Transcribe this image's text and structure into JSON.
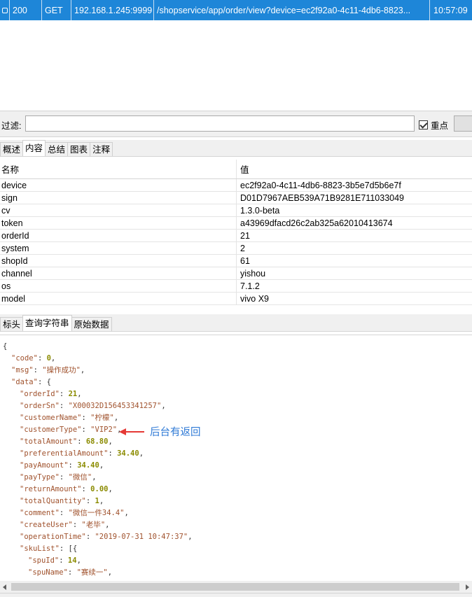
{
  "request": {
    "status": "200",
    "method": "GET",
    "host": "192.168.1.245:9999",
    "url": "/shopservice/app/order/view?device=ec2f92a0-4c11-4db6-8823...",
    "time": "10:57:09"
  },
  "filter": {
    "label": "过滤:",
    "value": "",
    "checkbox_label": "重点"
  },
  "tabs_top": [
    "概述",
    "内容",
    "总结",
    "图表",
    "注释"
  ],
  "params": {
    "header_name": "名称",
    "header_value": "值",
    "rows": [
      {
        "k": "device",
        "v": "ec2f92a0-4c11-4db6-8823-3b5e7d5b6e7f"
      },
      {
        "k": "sign",
        "v": "D01D7967AEB539A71B9281E711033049"
      },
      {
        "k": "cv",
        "v": "1.3.0-beta"
      },
      {
        "k": "token",
        "v": "a43969dfacd26c2ab325a62010413674"
      },
      {
        "k": "orderId",
        "v": "21"
      },
      {
        "k": "system",
        "v": "2"
      },
      {
        "k": "shopId",
        "v": "61"
      },
      {
        "k": "channel",
        "v": "yishou"
      },
      {
        "k": "os",
        "v": "7.1.2"
      },
      {
        "k": "model",
        "v": "vivo X9"
      }
    ]
  },
  "tabs_bottom": [
    "标头",
    "查询字符串",
    "原始数据"
  ],
  "json_lines": [
    {
      "indent": 0,
      "parts": [
        [
          "p",
          "{"
        ]
      ]
    },
    {
      "indent": 1,
      "parts": [
        [
          "k",
          "\"code\""
        ],
        [
          "p",
          ": "
        ],
        [
          "n",
          "0"
        ],
        [
          "p",
          ","
        ]
      ]
    },
    {
      "indent": 1,
      "parts": [
        [
          "k",
          "\"msg\""
        ],
        [
          "p",
          ": "
        ],
        [
          "s",
          "\"操作成功\""
        ],
        [
          "p",
          ","
        ]
      ]
    },
    {
      "indent": 1,
      "parts": [
        [
          "k",
          "\"data\""
        ],
        [
          "p",
          ": {"
        ]
      ]
    },
    {
      "indent": 2,
      "parts": [
        [
          "k",
          "\"orderId\""
        ],
        [
          "p",
          ": "
        ],
        [
          "n",
          "21"
        ],
        [
          "p",
          ","
        ]
      ]
    },
    {
      "indent": 2,
      "parts": [
        [
          "k",
          "\"orderSn\""
        ],
        [
          "p",
          ": "
        ],
        [
          "s",
          "\"X00032D156453341257\""
        ],
        [
          "p",
          ","
        ]
      ]
    },
    {
      "indent": 2,
      "parts": [
        [
          "k",
          "\"customerName\""
        ],
        [
          "p",
          ": "
        ],
        [
          "s",
          "\"柠檬\""
        ],
        [
          "p",
          ","
        ]
      ]
    },
    {
      "indent": 2,
      "parts": [
        [
          "k",
          "\"customerType\""
        ],
        [
          "p",
          ": "
        ],
        [
          "s",
          "\"VIP2\""
        ],
        [
          "p",
          ","
        ]
      ]
    },
    {
      "indent": 2,
      "parts": [
        [
          "k",
          "\"totalAmount\""
        ],
        [
          "p",
          ": "
        ],
        [
          "n",
          "68.80"
        ],
        [
          "p",
          ","
        ]
      ]
    },
    {
      "indent": 2,
      "parts": [
        [
          "k",
          "\"preferentialAmount\""
        ],
        [
          "p",
          ": "
        ],
        [
          "n",
          "34.40"
        ],
        [
          "p",
          ","
        ]
      ]
    },
    {
      "indent": 2,
      "parts": [
        [
          "k",
          "\"payAmount\""
        ],
        [
          "p",
          ": "
        ],
        [
          "n",
          "34.40"
        ],
        [
          "p",
          ","
        ]
      ]
    },
    {
      "indent": 2,
      "parts": [
        [
          "k",
          "\"payType\""
        ],
        [
          "p",
          ": "
        ],
        [
          "s",
          "\"微信\""
        ],
        [
          "p",
          ","
        ]
      ]
    },
    {
      "indent": 2,
      "parts": [
        [
          "k",
          "\"returnAmount\""
        ],
        [
          "p",
          ": "
        ],
        [
          "n",
          "0.00"
        ],
        [
          "p",
          ","
        ]
      ]
    },
    {
      "indent": 2,
      "parts": [
        [
          "k",
          "\"totalQuantity\""
        ],
        [
          "p",
          ": "
        ],
        [
          "n",
          "1"
        ],
        [
          "p",
          ","
        ]
      ]
    },
    {
      "indent": 2,
      "parts": [
        [
          "k",
          "\"comment\""
        ],
        [
          "p",
          ": "
        ],
        [
          "s",
          "\"微信一件34.4\""
        ],
        [
          "p",
          ","
        ]
      ]
    },
    {
      "indent": 2,
      "parts": [
        [
          "k",
          "\"createUser\""
        ],
        [
          "p",
          ": "
        ],
        [
          "s",
          "\"老毕\""
        ],
        [
          "p",
          ","
        ]
      ]
    },
    {
      "indent": 2,
      "parts": [
        [
          "k",
          "\"operationTime\""
        ],
        [
          "p",
          ": "
        ],
        [
          "s",
          "\"2019-07-31 10:47:37\""
        ],
        [
          "p",
          ","
        ]
      ]
    },
    {
      "indent": 2,
      "parts": [
        [
          "k",
          "\"skuList\""
        ],
        [
          "p",
          ": [{"
        ]
      ]
    },
    {
      "indent": 3,
      "parts": [
        [
          "k",
          "\"spuId\""
        ],
        [
          "p",
          ": "
        ],
        [
          "n",
          "14"
        ],
        [
          "p",
          ","
        ]
      ]
    },
    {
      "indent": 3,
      "parts": [
        [
          "k",
          "\"spuName\""
        ],
        [
          "p",
          ": "
        ],
        [
          "s",
          "\"赛续一\""
        ],
        [
          "p",
          ","
        ]
      ]
    }
  ],
  "annotation": {
    "text": "后台有返回",
    "arrow_color": "#e53935",
    "text_color": "#2f7ad6"
  },
  "colors": {
    "selected_row": "#1e86d8",
    "json_key": "#a0522d",
    "json_number": "#8b8b00"
  }
}
